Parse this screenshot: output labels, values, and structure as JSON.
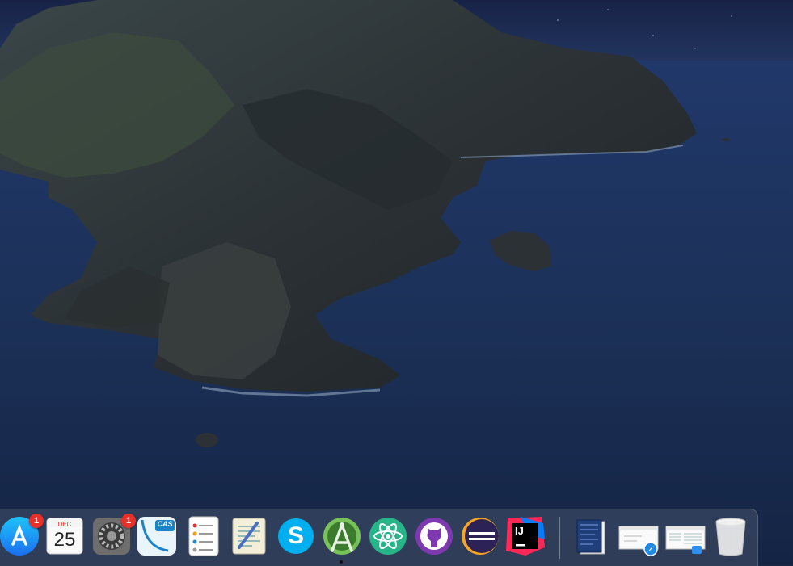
{
  "desktop": {
    "wallpaper": "macOS Catalina dark island",
    "sky_color": "#1f2c52",
    "sea_color": "#1c3357"
  },
  "dock": {
    "apps": [
      {
        "id": "app-store",
        "icon": "app-store-icon",
        "badge": "1"
      },
      {
        "id": "calendar",
        "icon": "calendar-icon",
        "month": "DEC",
        "day": "25"
      },
      {
        "id": "system-preferences",
        "icon": "gear-icon",
        "badge": "1"
      },
      {
        "id": "cas",
        "icon": "cas-icon",
        "label": "CAS"
      },
      {
        "id": "reminders",
        "icon": "reminders-icon"
      },
      {
        "id": "script-editor",
        "icon": "script-editor-icon"
      },
      {
        "id": "skype",
        "icon": "skype-icon",
        "label": "S"
      },
      {
        "id": "android-studio",
        "icon": "android-studio-icon",
        "running": true
      },
      {
        "id": "atom",
        "icon": "atom-icon"
      },
      {
        "id": "github-desktop",
        "icon": "github-icon"
      },
      {
        "id": "eclipse",
        "icon": "eclipse-icon"
      },
      {
        "id": "intellij-idea",
        "icon": "intellij-icon",
        "label": "IJ"
      }
    ],
    "recent": [
      {
        "id": "document-stack",
        "icon": "document-stack-icon"
      },
      {
        "id": "safari-window",
        "icon": "safari-window-icon"
      },
      {
        "id": "finder-window",
        "icon": "finder-window-icon"
      },
      {
        "id": "trash",
        "icon": "trash-icon"
      }
    ]
  }
}
